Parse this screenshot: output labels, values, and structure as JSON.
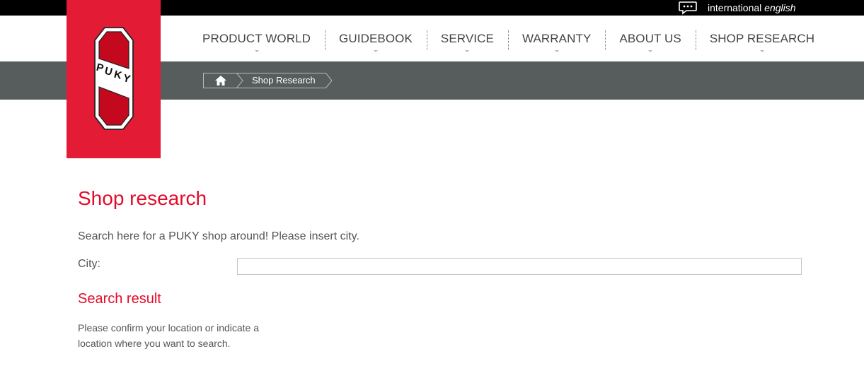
{
  "language": {
    "region": "international",
    "language": "english",
    "icon": "speech-bubble-icon"
  },
  "logo": {
    "text": "PUKY",
    "colors": {
      "background": "#e41b35",
      "shield": "#c4091e"
    }
  },
  "nav": {
    "items": [
      {
        "label": "PRODUCT WORLD"
      },
      {
        "label": "GUIDEBOOK"
      },
      {
        "label": "SERVICE"
      },
      {
        "label": "WARRANTY"
      },
      {
        "label": "ABOUT US"
      },
      {
        "label": "SHOP RESEARCH"
      }
    ]
  },
  "breadcrumb": {
    "home_icon": "home-icon",
    "current": "Shop Research"
  },
  "main": {
    "title": "Shop research",
    "intro": "Search here for a PUKY shop around! Please insert city.",
    "city_label": "City:",
    "city_value": "",
    "result_title": "Search result",
    "result_text": "Please confirm your location or indicate a location where you want to search."
  },
  "colors": {
    "accent": "#e30b2b",
    "topbar": "#000000",
    "graybar": "#575c5d"
  }
}
